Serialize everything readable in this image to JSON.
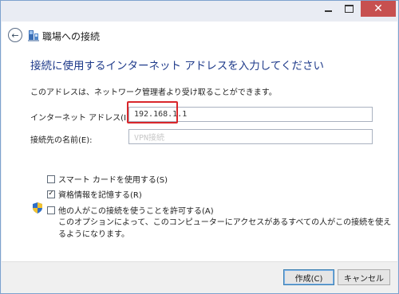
{
  "window": {
    "minimize_icon": "minimize-icon",
    "maximize_icon": "maximize-icon",
    "close_glyph": "✕"
  },
  "header": {
    "back_glyph": "←",
    "title": "職場への接続"
  },
  "main": {
    "instruction": "接続に使用するインターネット アドレスを入力してください",
    "description": "このアドレスは、ネットワーク管理者より受け取ることができます。",
    "address_label": "インターネット アドレス(I):",
    "address_value": "192.168.1.1",
    "name_label": "接続先の名前(E):",
    "name_value": "VPN接続"
  },
  "options": {
    "smartcard_label": "スマート カードを使用する(S)",
    "smartcard_checked": false,
    "save_credentials_label": "資格情報を記憶する(R)",
    "save_credentials_checked": true,
    "save_credentials_mark": "✓",
    "allow_others_label": "他の人がこの接続を使うことを許可する(A)",
    "allow_others_checked": false,
    "allow_others_note": "このオプションによって、このコンピューターにアクセスがあるすべての人がこの接続を使えるようになります。"
  },
  "footer": {
    "create_label": "作成(C)",
    "cancel_label": "キャンセル"
  },
  "colors": {
    "instruction": "#1e3a8a",
    "highlight": "#d8262b",
    "close_button": "#c75050"
  }
}
